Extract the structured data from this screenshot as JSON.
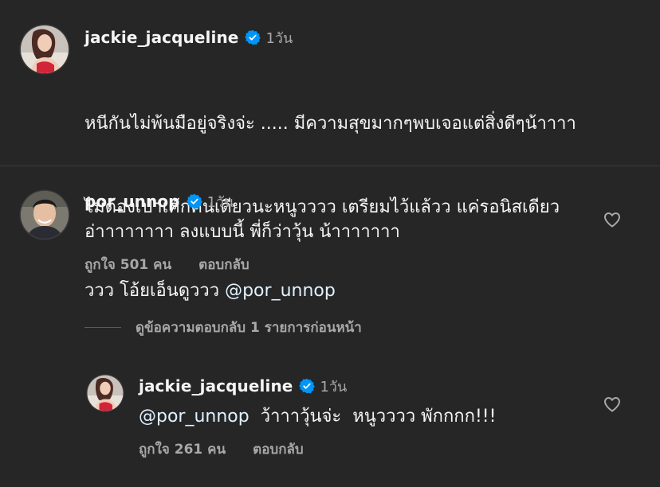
{
  "caption": {
    "username": "jackie_jacqueline",
    "time": "1วัน",
    "lines": [
      "หนีกันไม่พ้นมือยู่จริงจ่ะ ..... มีความสุขมากๆพบเจอแต่สิ่งดีๆน้าาาา",
      "ไม่ต้องเป่าเค้กคนเดียวนะหนูวววว เตรียมไว้แล้วว  แค่รอนิสเดียว",
      "ววว  โอ้ยเอ็นดูววว  "
    ],
    "mention": "@por_unnop"
  },
  "comments": [
    {
      "username": "por_unnop",
      "time": "1วัน",
      "text": "อ่าาาาาาาา ลงแบบนี้ พี่ก็ว่าวุ้น น้าาาาาาา",
      "likes": "ถูกใจ 501 คน",
      "reply_label": "ตอบกลับ"
    },
    {
      "username": "jackie_jacqueline",
      "time": "1วัน",
      "mention": "@por_unnop",
      "text": "  ว้าาาวุ้นจ่ะ  หนูวววว พักกกก!!!",
      "likes": "ถูกใจ 261 คน",
      "reply_label": "ตอบกลับ"
    }
  ],
  "view_replies": "ดูข้อความตอบกลับ 1 รายการก่อนหน้า",
  "icons": {
    "verified": "verified-badge-icon",
    "like": "heart-icon"
  },
  "colors": {
    "background": "#262626",
    "verified": "#0095f6",
    "secondary_text": "#a8a8a8"
  }
}
